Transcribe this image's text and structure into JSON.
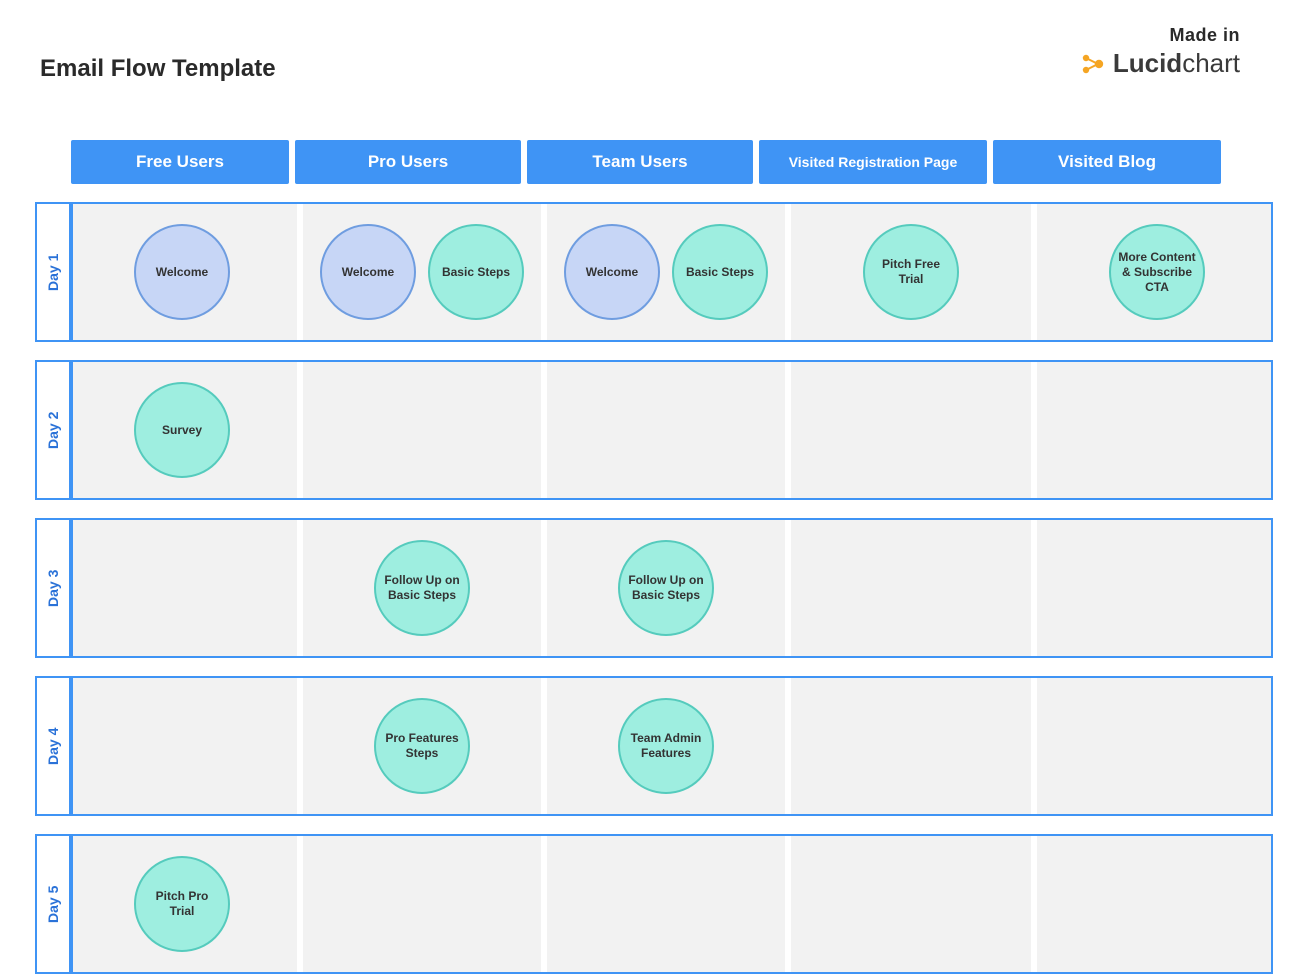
{
  "header": {
    "title": "Email Flow Template",
    "made_in": "Made in",
    "brand_bold": "Lucid",
    "brand_rest": "chart"
  },
  "colors": {
    "header_blue": "#3f94f5",
    "border_blue": "#3f94f5",
    "welcome_fill": "#c7d6f6",
    "welcome_stroke": "#6f9de0",
    "teal_fill": "#9eeee0",
    "teal_stroke": "#55cbbd",
    "row_bg": "#f2f2f2",
    "logo_orange": "#f5a523"
  },
  "columns": [
    {
      "key": "free",
      "label": "Free Users"
    },
    {
      "key": "pro",
      "label": "Pro Users"
    },
    {
      "key": "team",
      "label": "Team Users"
    },
    {
      "key": "reg",
      "label": "Visited  Registration Page"
    },
    {
      "key": "blog",
      "label": "Visited Blog"
    }
  ],
  "rows": [
    {
      "key": "d1",
      "label": "Day 1"
    },
    {
      "key": "d2",
      "label": "Day 2"
    },
    {
      "key": "d3",
      "label": "Day 3"
    },
    {
      "key": "d4",
      "label": "Day 4"
    },
    {
      "key": "d5",
      "label": "Day 5"
    }
  ],
  "cells": {
    "d1": {
      "free": [
        {
          "style": "welcome",
          "text": "Welcome"
        }
      ],
      "pro": [
        {
          "style": "welcome",
          "text": "Welcome"
        },
        {
          "style": "teal",
          "text": "Basic Steps"
        }
      ],
      "team": [
        {
          "style": "welcome",
          "text": "Welcome"
        },
        {
          "style": "teal",
          "text": "Basic Steps"
        }
      ],
      "reg": [
        {
          "style": "teal",
          "text": "Pitch Free Trial"
        }
      ],
      "blog": [
        {
          "style": "teal",
          "text": "More Content & Subscribe CTA"
        }
      ]
    },
    "d2": {
      "free": [
        {
          "style": "teal",
          "text": "Survey"
        }
      ],
      "pro": [],
      "team": [],
      "reg": [],
      "blog": []
    },
    "d3": {
      "free": [],
      "pro": [
        {
          "style": "teal",
          "text": "Follow Up on Basic Steps"
        }
      ],
      "team": [
        {
          "style": "teal",
          "text": "Follow Up on Basic Steps"
        }
      ],
      "reg": [],
      "blog": []
    },
    "d4": {
      "free": [],
      "pro": [
        {
          "style": "teal",
          "text": "Pro Features Steps"
        }
      ],
      "team": [
        {
          "style": "teal",
          "text": "Team Admin Features"
        }
      ],
      "reg": [],
      "blog": []
    },
    "d5": {
      "free": [
        {
          "style": "teal",
          "text": "Pitch Pro Trial"
        }
      ],
      "pro": [],
      "team": [],
      "reg": [],
      "blog": []
    }
  }
}
